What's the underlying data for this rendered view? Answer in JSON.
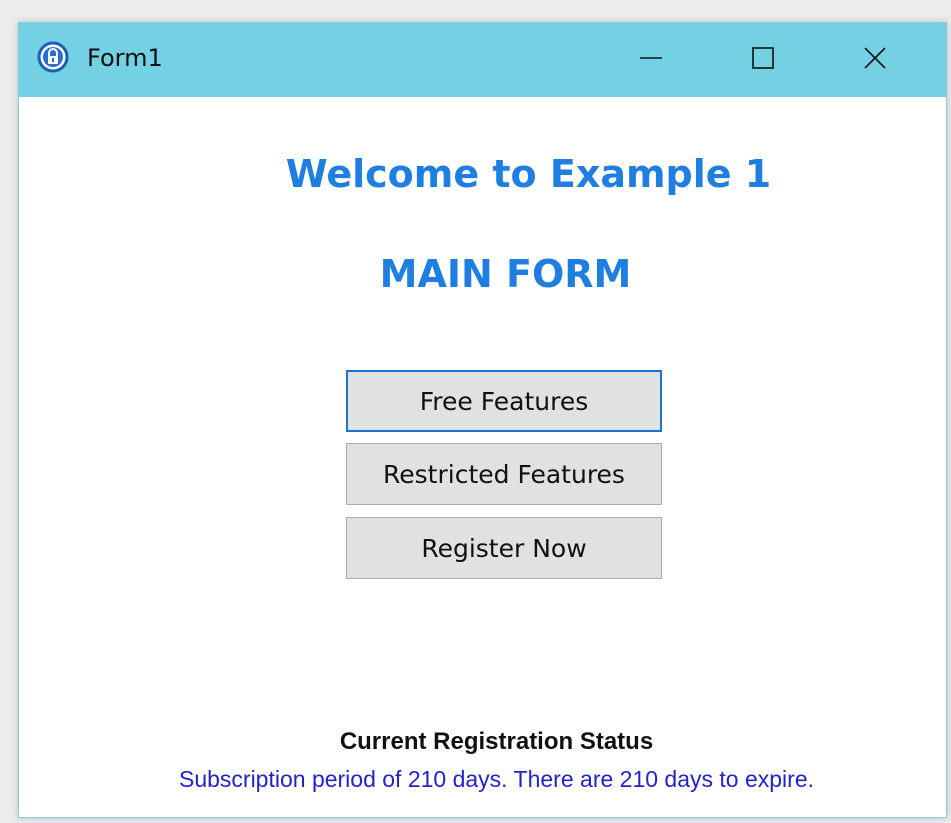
{
  "window": {
    "title": "Form1",
    "icon": "lock-icon",
    "controls": {
      "minimize": "minimize-icon",
      "maximize": "maximize-icon",
      "close": "close-icon"
    }
  },
  "main": {
    "welcome_heading": "Welcome to Example 1",
    "form_heading": "MAIN FORM",
    "buttons": [
      {
        "label": "Free Features",
        "focused": true
      },
      {
        "label": "Restricted Features",
        "focused": false
      },
      {
        "label": "Register Now",
        "focused": false
      }
    ]
  },
  "status": {
    "title": "Current Registration Status",
    "message": "Subscription period of 210 days. There are 210 days to expire."
  },
  "colors": {
    "titlebar": "#74d0e3",
    "heading": "#1e7fe0",
    "status_message": "#2323c8",
    "button_face": "#e1e1e1",
    "focus_border": "#1a76cf"
  }
}
